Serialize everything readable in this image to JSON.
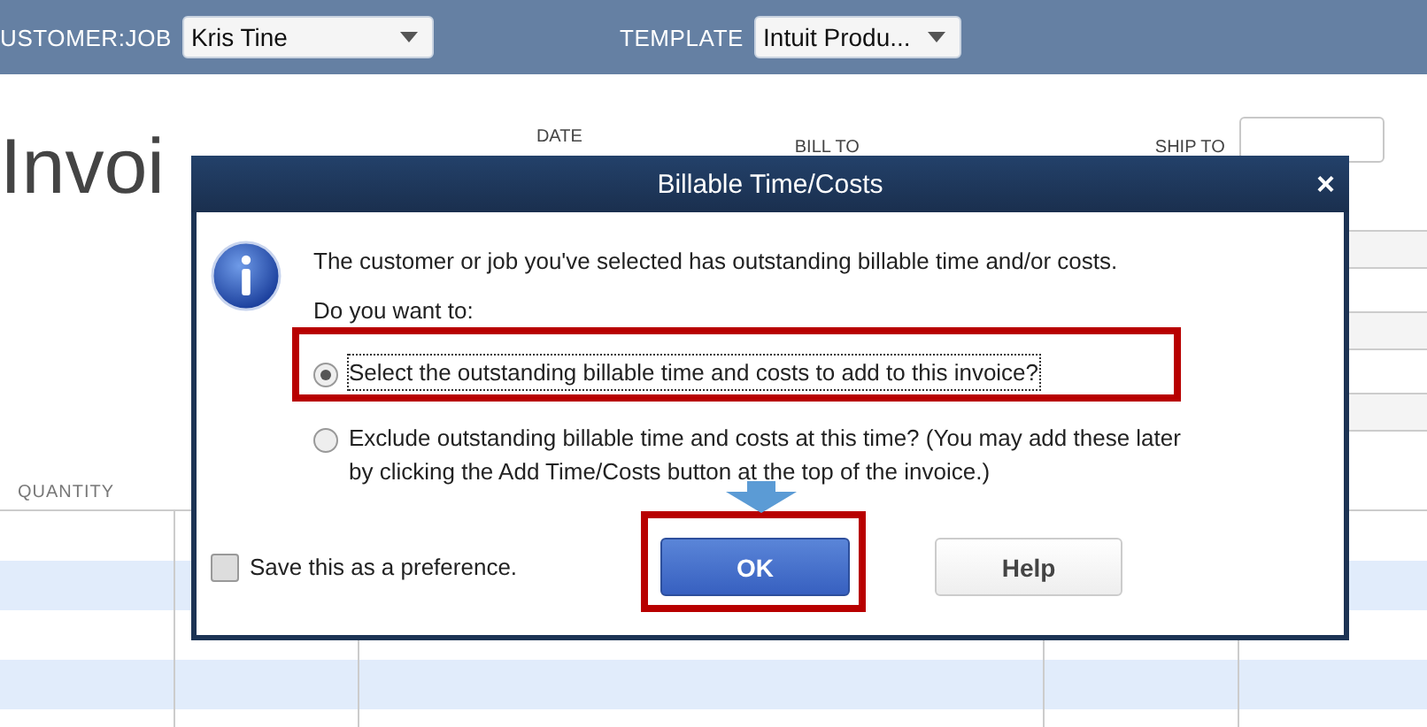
{
  "toolbar": {
    "customer_job": {
      "label": "USTOMER:JOB",
      "value": "Kris Tine"
    },
    "template": {
      "label": "TEMPLATE",
      "value": "Intuit Produ..."
    }
  },
  "form": {
    "title": "Invoi",
    "date_label": "DATE",
    "bill_to_label": "BILL TO",
    "ship_to_label": "SHIP TO"
  },
  "table": {
    "columns": [
      "QUANTITY"
    ]
  },
  "dialog": {
    "title": "Billable Time/Costs",
    "close": "×",
    "message": "The customer or job you've selected has outstanding billable time and/or costs.",
    "prompt": "Do you want to:",
    "options": [
      {
        "label": "Select the outstanding billable time and costs to add to this invoice?",
        "selected": true
      },
      {
        "label": "Exclude outstanding billable time and costs at this time? (You may add these later by clicking the Add Time/Costs button at the top of the invoice.)",
        "selected": false
      }
    ],
    "preference": {
      "label": "Save this as a preference.",
      "checked": false
    },
    "buttons": [
      {
        "label": "OK",
        "kind": "primary"
      },
      {
        "label": "Help",
        "kind": "default"
      }
    ]
  }
}
